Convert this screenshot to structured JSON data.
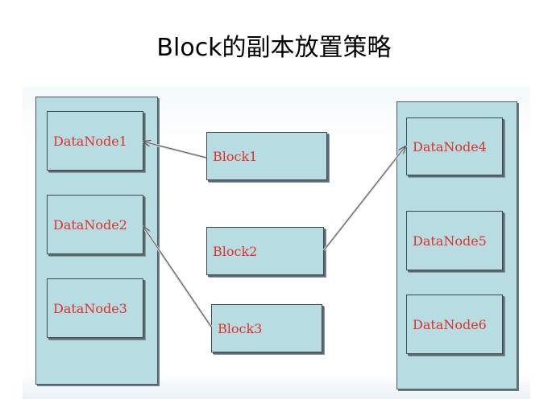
{
  "title": "Block的副本放置策略",
  "left_rack": {
    "nodes": [
      "DataNode1",
      "DataNode2",
      "DataNode3"
    ]
  },
  "right_rack": {
    "nodes": [
      "DataNode4",
      "DataNode5",
      "DataNode6"
    ]
  },
  "blocks": [
    "Block1",
    "Block2",
    "Block3"
  ],
  "colors": {
    "box_fill": "#b7dde2",
    "label_text": "#e0302a",
    "border": "#3c4a50",
    "arrow": "#555555"
  }
}
